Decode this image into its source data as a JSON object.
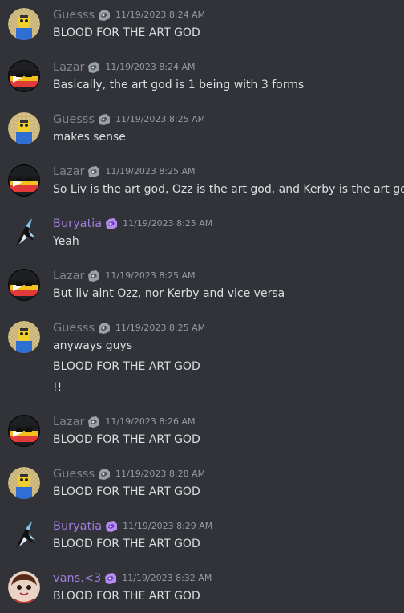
{
  "colors": {
    "background": "#313338",
    "text": "#dbdee1",
    "timestamp": "#949ba4",
    "grey_name": "#80848e",
    "purple_name": "#a07cdc"
  },
  "messages": [
    {
      "author": "Guesss",
      "avatar": "guesss",
      "name_color": "#80848e",
      "badge": "grey-badge-icon",
      "timestamp": "11/19/2023 8:24 AM",
      "lines": [
        "BLOOD FOR THE ART GOD"
      ]
    },
    {
      "author": "Lazar",
      "avatar": "lazar",
      "name_color": "#80848e",
      "badge": "grey-badge-icon",
      "timestamp": "11/19/2023 8:24 AM",
      "lines": [
        "Basically, the art god is 1 being with 3 forms"
      ]
    },
    {
      "author": "Guesss",
      "avatar": "guesss",
      "name_color": "#80848e",
      "badge": "grey-badge-icon",
      "timestamp": "11/19/2023 8:25 AM",
      "lines": [
        "makes sense"
      ]
    },
    {
      "author": "Lazar",
      "avatar": "lazar",
      "name_color": "#80848e",
      "badge": "grey-badge-icon",
      "timestamp": "11/19/2023 8:25 AM",
      "lines": [
        "So Liv is the art god, Ozz is the art god, and Kerby is the art god"
      ]
    },
    {
      "author": "Buryatia",
      "avatar": "buryatia",
      "name_color": "#a07cdc",
      "badge": "purple-badge-icon",
      "timestamp": "11/19/2023 8:25 AM",
      "lines": [
        "Yeah"
      ]
    },
    {
      "author": "Lazar",
      "avatar": "lazar",
      "name_color": "#80848e",
      "badge": "grey-badge-icon",
      "timestamp": "11/19/2023 8:25 AM",
      "lines": [
        "But liv aint Ozz, nor Kerby and vice versa"
      ]
    },
    {
      "author": "Guesss",
      "avatar": "guesss",
      "name_color": "#80848e",
      "badge": "grey-badge-icon",
      "timestamp": "11/19/2023 8:25 AM",
      "lines": [
        "anyways guys",
        "BLOOD FOR THE ART GOD",
        "!!"
      ]
    },
    {
      "author": "Lazar",
      "avatar": "lazar",
      "name_color": "#80848e",
      "badge": "grey-badge-icon",
      "timestamp": "11/19/2023 8:26 AM",
      "lines": [
        "BLOOD FOR THE ART GOD"
      ]
    },
    {
      "author": "Guesss",
      "avatar": "guesss",
      "name_color": "#80848e",
      "badge": "grey-badge-icon",
      "timestamp": "11/19/2023 8:28 AM",
      "lines": [
        "BLOOD FOR THE ART GOD"
      ]
    },
    {
      "author": "Buryatia",
      "avatar": "buryatia",
      "name_color": "#a07cdc",
      "badge": "purple-badge-icon",
      "timestamp": "11/19/2023 8:29 AM",
      "lines": [
        "BLOOD FOR THE ART GOD"
      ]
    },
    {
      "author": "vans.<3",
      "avatar": "vans",
      "name_color": "#a07cdc",
      "badge": "purple-badge-icon",
      "timestamp": "11/19/2023 8:32 AM",
      "lines": [
        "BLOOD FOR THE ART GOD"
      ]
    }
  ]
}
